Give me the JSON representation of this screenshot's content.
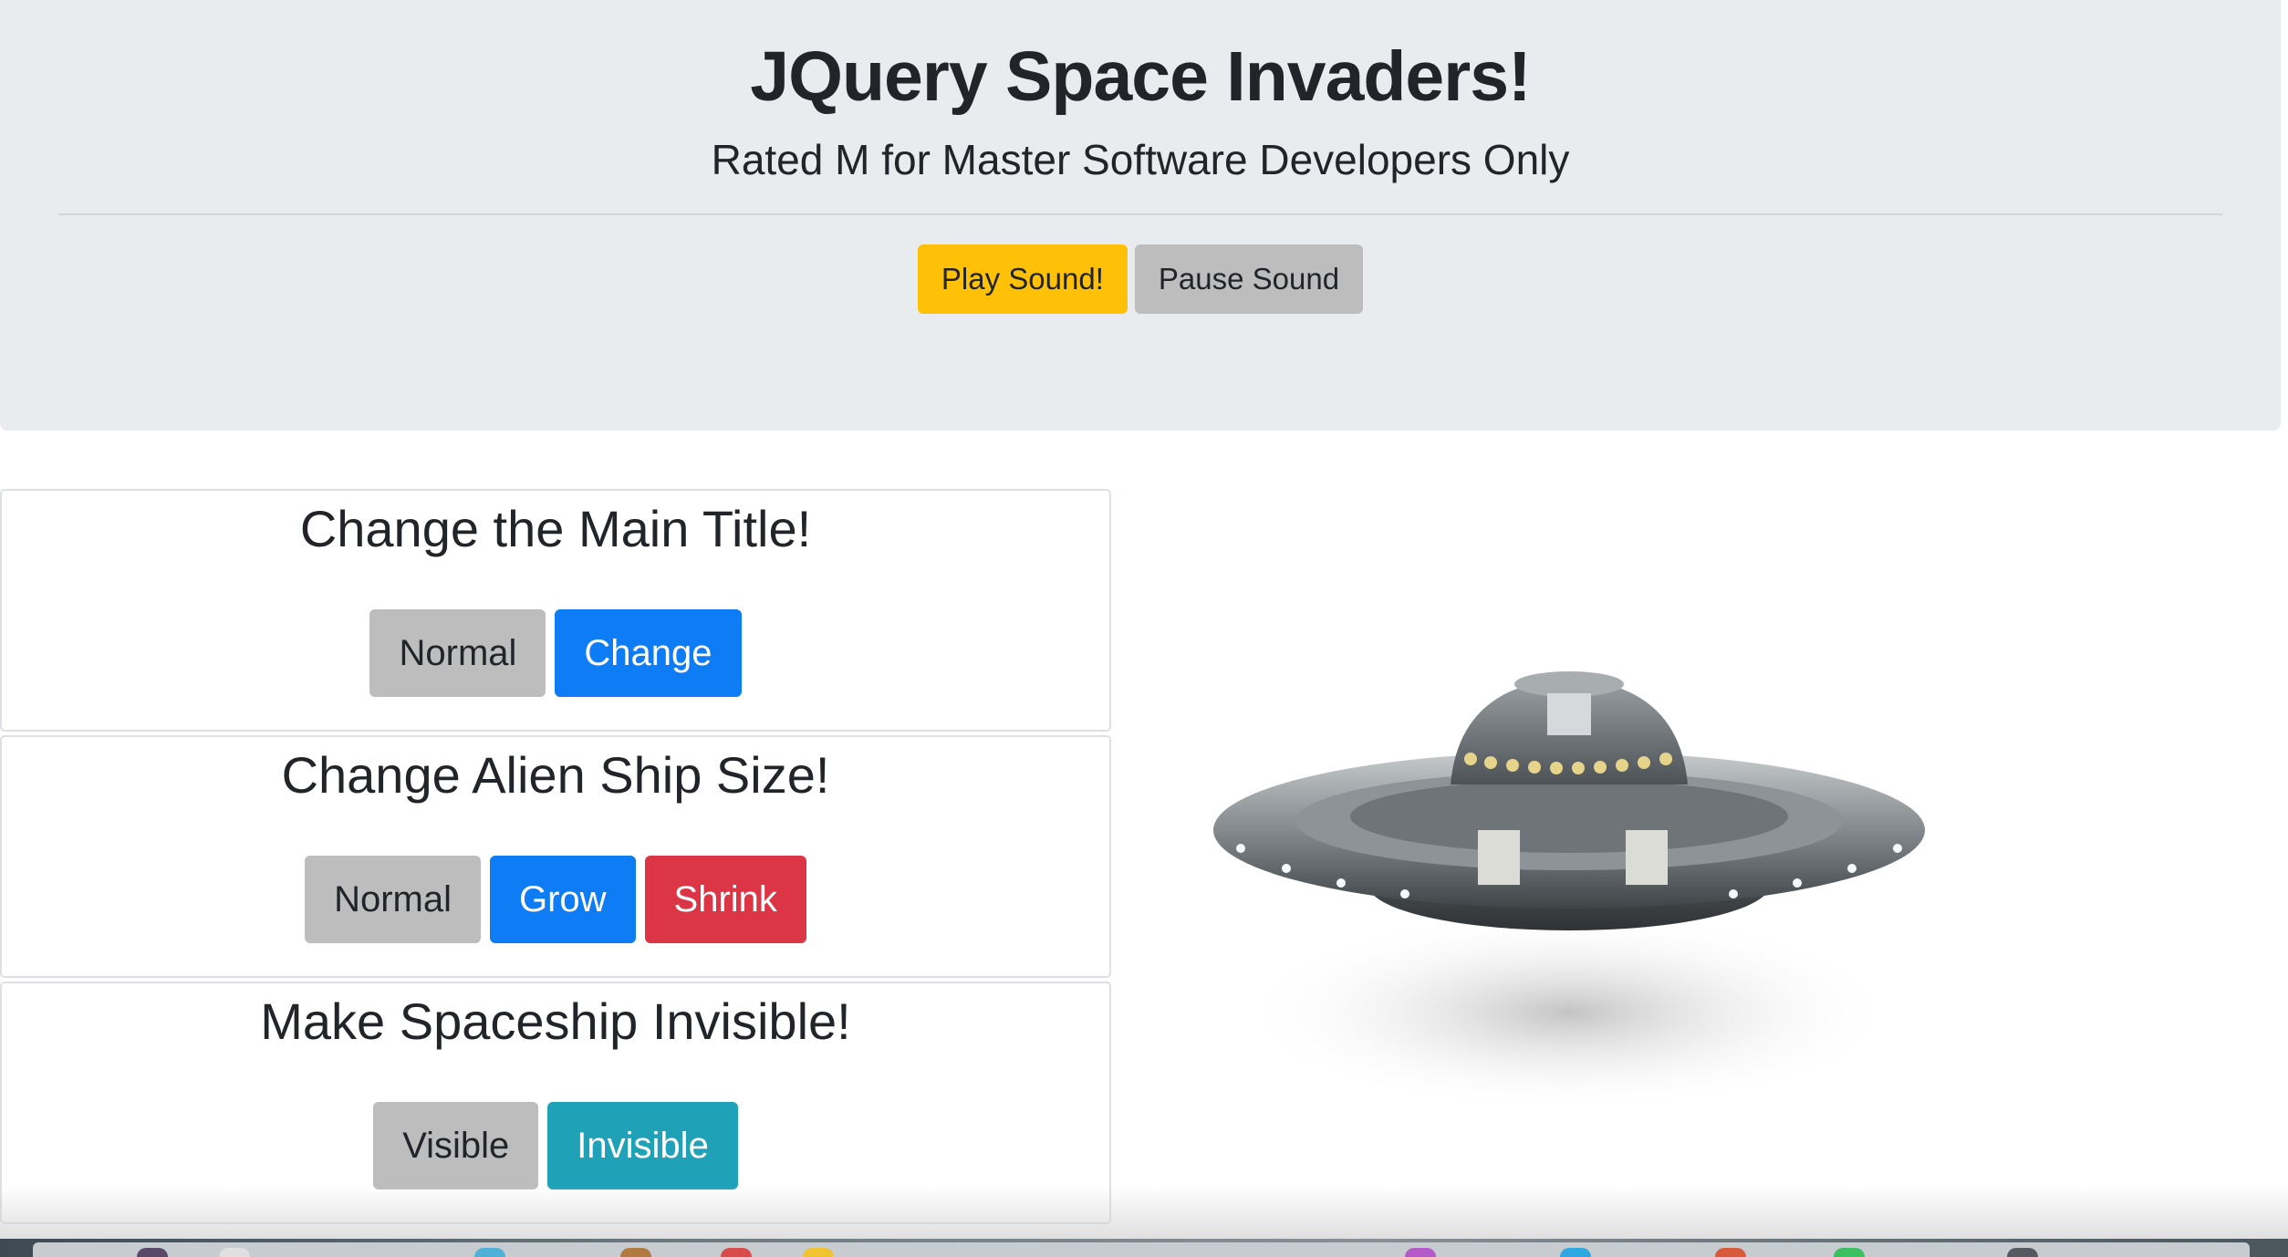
{
  "header": {
    "title": "JQuery Space Invaders!",
    "subtitle": "Rated M for Master Software Developers Only",
    "play_sound_label": "Play Sound!",
    "pause_sound_label": "Pause Sound"
  },
  "panels": [
    {
      "title": "Change the Main Title!",
      "buttons": [
        "Normal",
        "Change"
      ]
    },
    {
      "title": "Change Alien Ship Size!",
      "buttons": [
        "Normal",
        "Grow",
        "Shrink"
      ]
    },
    {
      "title": "Make Spaceship Invisible!",
      "buttons": [
        "Visible",
        "Invisible"
      ]
    }
  ],
  "colors": {
    "warning": "#ffc107",
    "primary": "#0d7cf5",
    "danger": "#dc3545",
    "info": "#1fa2b8",
    "secondary": "#bdbdbd",
    "jumbotron": "#e9ecef"
  },
  "images": {
    "spaceship": "ufo-spaceship-image"
  }
}
